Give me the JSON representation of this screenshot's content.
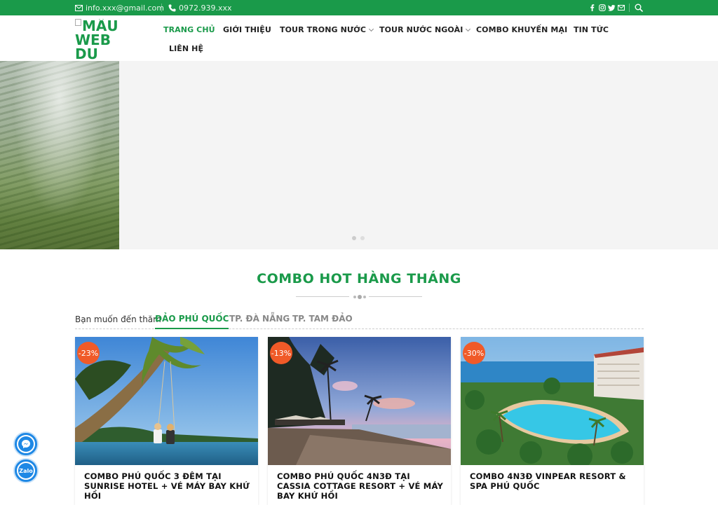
{
  "topbar": {
    "email": "info.xxx@gmail.com",
    "phone": "0972.939.xxx",
    "social_icons": [
      "facebook-icon",
      "instagram-icon",
      "twitter-icon",
      "mail-icon"
    ],
    "search_icon": "search-icon"
  },
  "header": {
    "logo_alt": "MẪU WEB DU",
    "nav": [
      {
        "label": "TRANG CHỦ",
        "active": true
      },
      {
        "label": "GIỚI THIỆU"
      },
      {
        "label": "TOUR TRONG NƯỚC",
        "dropdown": true
      },
      {
        "label": "TOUR NƯỚC NGOÀI",
        "dropdown": true
      },
      {
        "label": "COMBO KHUYẾN MẠI"
      },
      {
        "label": "TIN TỨC"
      },
      {
        "label": "LIÊN HỆ"
      }
    ]
  },
  "slider": {
    "dots": 2,
    "active_dot": 0
  },
  "section": {
    "title": "COMBO HOT HÀNG THÁNG",
    "tabs_label": "Bạn muốn đến thăm",
    "tabs": [
      {
        "label": "ĐẢO PHÚ QUỐC",
        "active": true
      },
      {
        "label": "TP. ĐÀ NẴNG"
      },
      {
        "label": "TP. TAM ĐẢO"
      }
    ]
  },
  "cards": [
    {
      "badge": "-23%",
      "title": "COMBO PHÚ QUỐC 3 ĐÊM TẠI SUNRISE HOTEL + VÉ MÁY BAY KHỨ HỒI"
    },
    {
      "badge": "-13%",
      "title": "COMBO PHÚ QUỐC 4N3Đ TẠI CASSIA COTTAGE RESORT + VÉ MÁY BAY KHỨ HỒI"
    },
    {
      "badge": "-30%",
      "title": "COMBO 4N3Đ VINPEAR RESORT & SPA PHÚ QUỐC"
    }
  ],
  "floating": [
    {
      "icon": "messenger-icon"
    },
    {
      "icon": "zalo-icon",
      "label": "Zalo"
    }
  ],
  "colors": {
    "brand": "#1a9a4a",
    "badge": "#f05a28",
    "fab": "#1e88e5"
  }
}
